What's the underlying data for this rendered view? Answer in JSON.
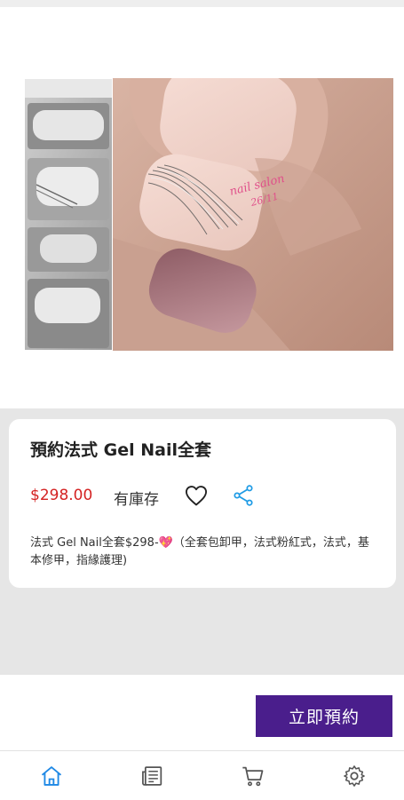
{
  "product": {
    "title": "預約法式 Gel Nail全套",
    "price": "$298.00",
    "stock": "有庫存",
    "description": "法式 Gel Nail全套$298-💖（全套包卸甲，法式粉紅式，法式，基本修甲，指緣護理)"
  },
  "actions": {
    "book_label": "立即預約"
  },
  "icons": {
    "favorite": "heart-icon",
    "share": "share-icon"
  },
  "bottom_nav": {
    "items": [
      "home-icon",
      "news-icon",
      "cart-icon",
      "settings-icon"
    ],
    "active": "home-icon"
  },
  "colors": {
    "accent": "#4a1e8c",
    "price": "#d42323",
    "active_nav": "#1e88e5",
    "share_icon": "#1e9be5"
  }
}
